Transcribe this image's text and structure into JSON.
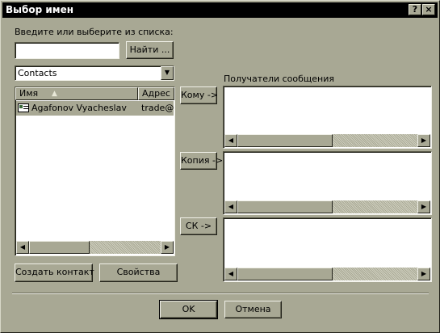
{
  "window": {
    "title": "Выбор имен"
  },
  "titlebar": {
    "help_label": "?",
    "close_label": "×"
  },
  "search": {
    "prompt": "Введите или выберите из списка:",
    "value": "",
    "find_button": "Найти ..."
  },
  "address_book": {
    "selected": "Contacts"
  },
  "contacts_list": {
    "columns": [
      "Имя",
      "Адрес э"
    ],
    "sort_glyph": "▲",
    "rows": [
      {
        "name": "Agafonov Vyacheslav",
        "address": "trade@b"
      }
    ]
  },
  "recipients": {
    "label": "Получатели сообщения",
    "to_button": "Кому ->",
    "cc_button": "Копия ->",
    "bcc_button": "СК ->"
  },
  "actions": {
    "new_contact": "Создать контакт",
    "properties": "Свойства"
  },
  "footer": {
    "ok": "OK",
    "cancel": "Отмена"
  },
  "scroll": {
    "left": "◀",
    "right": "▶",
    "down": "▼"
  }
}
